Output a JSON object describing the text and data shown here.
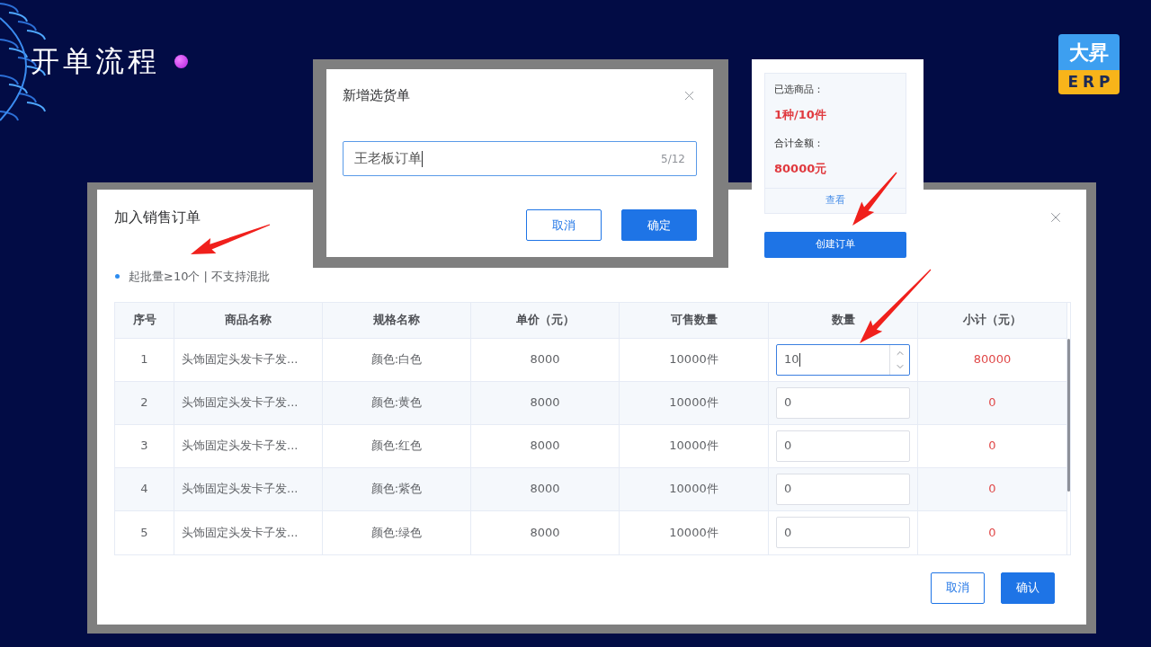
{
  "slide": {
    "title": "开单流程"
  },
  "logo": {
    "top": "大昇",
    "bottom": "ERP"
  },
  "new_selection_dialog": {
    "title": "新增选货单",
    "name_field": {
      "value": "王老板订单",
      "counter": "5/12",
      "focused": true
    },
    "buttons": [
      {
        "label": "取消",
        "kind": "secondary"
      },
      {
        "label": "确定",
        "kind": "primary"
      }
    ]
  },
  "selection_summary": {
    "items_label": "已选商品：",
    "items_value": "1种/10件",
    "total_label": "合计金额：",
    "total_value": "80000元",
    "view_link": "查看",
    "create_button": "创建订单"
  },
  "order_dialog": {
    "title": "加入销售订单",
    "note": "起批量≥10个 | 不支持混批",
    "table": {
      "columns": [
        "序号",
        "商品名称",
        "规格名称",
        "单价（元）",
        "可售数量",
        "数量",
        "小计（元）"
      ],
      "rows": [
        {
          "index": "1",
          "name": "头饰固定头发卡子发...",
          "spec": "颜色:白色",
          "price": "8000",
          "available": "10000件",
          "quantity": "10",
          "focused": true,
          "subtotal": "80000"
        },
        {
          "index": "2",
          "name": "头饰固定头发卡子发...",
          "spec": "颜色:黄色",
          "price": "8000",
          "available": "10000件",
          "quantity": "0",
          "focused": false,
          "subtotal": "0"
        },
        {
          "index": "3",
          "name": "头饰固定头发卡子发...",
          "spec": "颜色:红色",
          "price": "8000",
          "available": "10000件",
          "quantity": "0",
          "focused": false,
          "subtotal": "0"
        },
        {
          "index": "4",
          "name": "头饰固定头发卡子发...",
          "spec": "颜色:紫色",
          "price": "8000",
          "available": "10000件",
          "quantity": "0",
          "focused": false,
          "subtotal": "0"
        },
        {
          "index": "5",
          "name": "头饰固定头发卡子发...",
          "spec": "颜色:绿色",
          "price": "8000",
          "available": "10000件",
          "quantity": "0",
          "focused": false,
          "subtotal": "0"
        }
      ]
    },
    "buttons": [
      {
        "label": "取消",
        "kind": "secondary"
      },
      {
        "label": "确认",
        "kind": "primary"
      }
    ]
  }
}
